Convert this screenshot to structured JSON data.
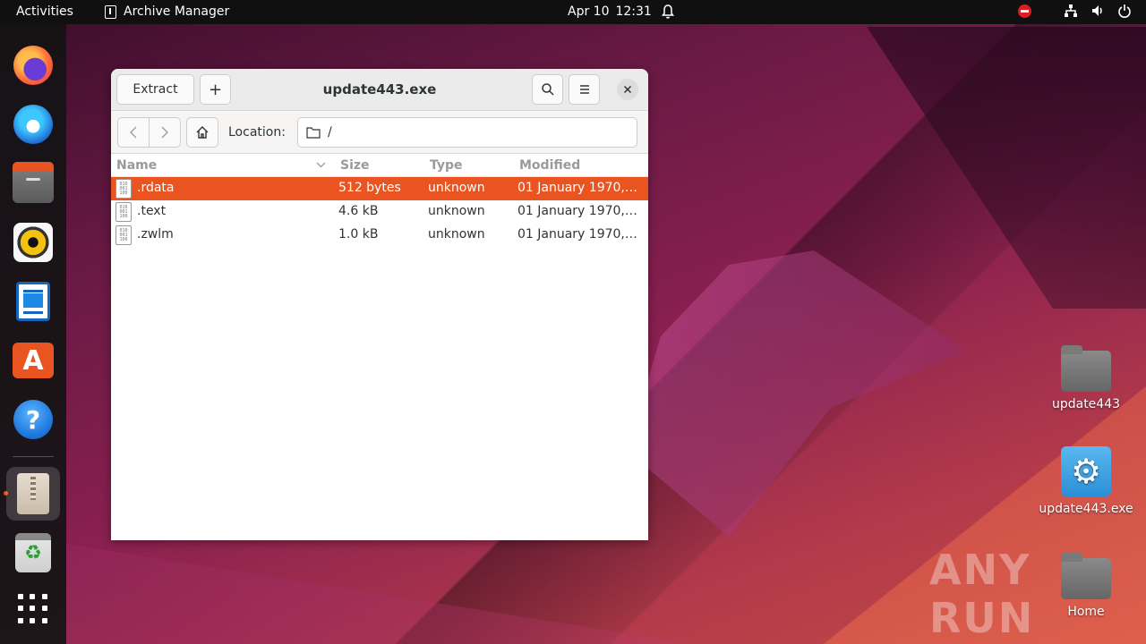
{
  "topbar": {
    "activities": "Activities",
    "app_name": "Archive Manager",
    "date": "Apr 10",
    "time": "12:31"
  },
  "dock": {
    "items": [
      {
        "name": "firefox"
      },
      {
        "name": "thunderbird"
      },
      {
        "name": "files"
      },
      {
        "name": "rhythmbox"
      },
      {
        "name": "libreoffice-writer"
      },
      {
        "name": "app-center"
      },
      {
        "name": "help"
      },
      {
        "name": "archive-manager",
        "active": true
      },
      {
        "name": "trash"
      },
      {
        "name": "show-apps"
      }
    ]
  },
  "window": {
    "title": "update443.exe",
    "extract_label": "Extract",
    "add_label": "+",
    "location_label": "Location:",
    "location_value": "/",
    "columns": [
      "Name",
      "Size",
      "Type",
      "Modified"
    ],
    "files": [
      {
        "name": ".rdata",
        "size": "512 bytes",
        "type": "unknown",
        "modified": "01 January 1970,…",
        "selected": true
      },
      {
        "name": ".text",
        "size": "4.6 kB",
        "type": "unknown",
        "modified": "01 January 1970,…",
        "selected": false
      },
      {
        "name": ".zwlm",
        "size": "1.0 kB",
        "type": "unknown",
        "modified": "01 January 1970,…",
        "selected": false
      }
    ]
  },
  "desktop": {
    "icons": [
      {
        "label": "update443",
        "kind": "folder"
      },
      {
        "label": "update443.exe",
        "kind": "exe"
      },
      {
        "label": "Home",
        "kind": "folder"
      }
    ]
  },
  "watermark": "ANY RUN",
  "colors": {
    "accent": "#e95420",
    "topbar": "#101010",
    "dock": "#1a1a1a"
  }
}
